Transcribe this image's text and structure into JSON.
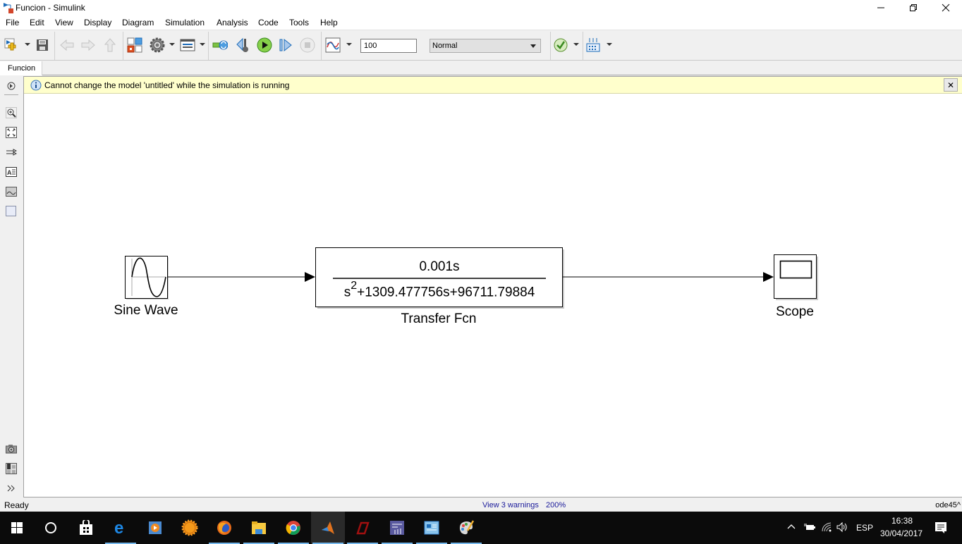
{
  "window": {
    "title": "Funcion - Simulink",
    "minimize_label": "—",
    "restore_label": "❐",
    "close_label": "✕"
  },
  "menu": [
    "File",
    "Edit",
    "View",
    "Display",
    "Diagram",
    "Simulation",
    "Analysis",
    "Code",
    "Tools",
    "Help"
  ],
  "toolbar": {
    "stop_time": "100",
    "sim_mode": "Normal",
    "icons": [
      "new-model-icon",
      "save-icon",
      "back-icon",
      "forward-icon",
      "up-icon",
      "library-browser-icon",
      "model-config-icon",
      "model-explorer-icon",
      "step-back-icon",
      "step-back-config-icon",
      "run-icon",
      "step-forward-icon",
      "stop-icon",
      "data-inspector-icon",
      "check-icon",
      "build-icon"
    ]
  },
  "tabs": [
    {
      "label": "Funcion"
    }
  ],
  "infobar": {
    "message": "Cannot change the model 'untitled' while the simulation is running",
    "close_label": "✕"
  },
  "blocks": {
    "sine": {
      "label": "Sine Wave"
    },
    "tf": {
      "label": "Transfer Fcn",
      "numerator": "0.001s",
      "denominator_s": "s",
      "denominator_exp": "2",
      "denominator_rest": "+1309.477756s+96711.79884"
    },
    "scope": {
      "label": "Scope"
    }
  },
  "status": {
    "ready": "Ready",
    "warnings": "View 3 warnings",
    "zoom": "200%",
    "solver": "ode45^"
  },
  "taskbar": {
    "apps": [
      "start",
      "cortana",
      "store",
      "edge",
      "media-player",
      "weather",
      "firefox",
      "file-explorer",
      "chrome",
      "matlab",
      "acrobat",
      "app-settings",
      "control-panel",
      "paint"
    ],
    "tray": {
      "language": "ESP",
      "time": "16:38",
      "date": "30/04/2017"
    }
  }
}
